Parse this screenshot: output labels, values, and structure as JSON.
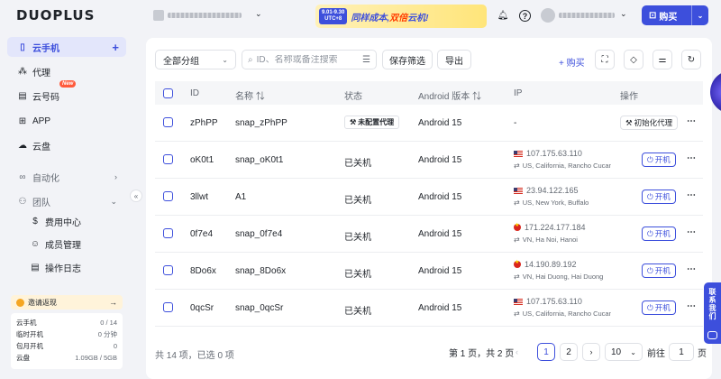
{
  "brand": {
    "logo_text": "DUOPLUS"
  },
  "sidebar": {
    "items": [
      {
        "label": "云手机",
        "icon": "phone-icon",
        "active": true
      },
      {
        "label": "代理",
        "icon": "proxy-icon"
      },
      {
        "label": "云号码",
        "icon": "sim-icon",
        "badge": "New"
      },
      {
        "label": "APP",
        "icon": "apps-grid-icon"
      },
      {
        "label": "云盘",
        "icon": "cloud-icon"
      },
      {
        "label": "自动化",
        "icon": "infinity-icon"
      },
      {
        "label": "团队",
        "icon": "team-icon"
      },
      {
        "label": "费用中心",
        "icon": "dollar-icon"
      },
      {
        "label": "成员管理",
        "icon": "member-icon"
      },
      {
        "label": "操作日志",
        "icon": "log-icon"
      }
    ],
    "invite_label": "邀请返现",
    "stats": [
      {
        "label": "云手机",
        "value": "0 / 14"
      },
      {
        "label": "临时开机",
        "value": "0 分钟"
      },
      {
        "label": "包月开机",
        "value": "0"
      },
      {
        "label": "云盘",
        "value": "1.09GB / 5GB"
      }
    ]
  },
  "topbar": {
    "promo": {
      "date": "9.01-9.30",
      "tz": "UTC+8",
      "text_a": "同样成本,",
      "text_b": "双倍",
      "text_c": "云机!"
    },
    "buy_label": "购买",
    "help_glyph": "?"
  },
  "toolbar": {
    "group_select": "全部分组",
    "search_placeholder": "ID、名称或备注搜索",
    "save_filter": "保存筛选",
    "export": "导出",
    "buy": "+ 购买"
  },
  "table": {
    "headers": [
      "ID",
      "名称 ⇅",
      "状态",
      "Android 版本 ⇅",
      "IP",
      "操作"
    ],
    "rows": [
      {
        "id": "zPhPP",
        "name": "snap_zPhPP",
        "status": "未配置代理",
        "status_type": "warn",
        "android": "Android 15",
        "ip": "-",
        "ip_loc": "",
        "flag": "",
        "action": "初始化代理",
        "action_type": "gray"
      },
      {
        "id": "oK0t1",
        "name": "snap_oK0t1",
        "status": "已关机",
        "status_type": "off",
        "android": "Android 15",
        "ip": "107.175.63.110",
        "ip_loc": "US, California, Rancho Cucamonga",
        "flag": "us",
        "action": "开机",
        "action_type": "primary"
      },
      {
        "id": "3llwt",
        "name": "A1",
        "status": "已关机",
        "status_type": "off",
        "android": "Android 15",
        "ip": "23.94.122.165",
        "ip_loc": "US, New York, Buffalo",
        "flag": "us",
        "action": "开机",
        "action_type": "primary"
      },
      {
        "id": "0f7e4",
        "name": "snap_0f7e4",
        "status": "已关机",
        "status_type": "off",
        "android": "Android 15",
        "ip": "171.224.177.184",
        "ip_loc": "VN, Ha Noi, Hanoi",
        "flag": "vn",
        "action": "开机",
        "action_type": "primary"
      },
      {
        "id": "8Do6x",
        "name": "snap_8Do6x",
        "status": "已关机",
        "status_type": "off",
        "android": "Android 15",
        "ip": "14.190.89.192",
        "ip_loc": "VN, Hai Duong, Hai Duong",
        "flag": "vn",
        "action": "开机",
        "action_type": "primary"
      },
      {
        "id": "0qcSr",
        "name": "snap_0qcSr",
        "status": "已关机",
        "status_type": "off",
        "android": "Android 15",
        "ip": "107.175.63.110",
        "ip_loc": "US, California, Rancho Cucamonga",
        "flag": "us",
        "action": "开机",
        "action_type": "primary"
      }
    ]
  },
  "footer": {
    "summary": "共 14 项，已选 0 项",
    "page_info": "第 1 页，共 2 页",
    "pages": [
      "1",
      "2"
    ],
    "current_page": "1",
    "page_size": "10",
    "goto_label": "前往",
    "goto_value": "1",
    "page_unit": "页"
  },
  "float_tab": {
    "label": "联系我们"
  },
  "colors": {
    "accent": "#3d4fdc",
    "badge": "#ff5a3c"
  }
}
